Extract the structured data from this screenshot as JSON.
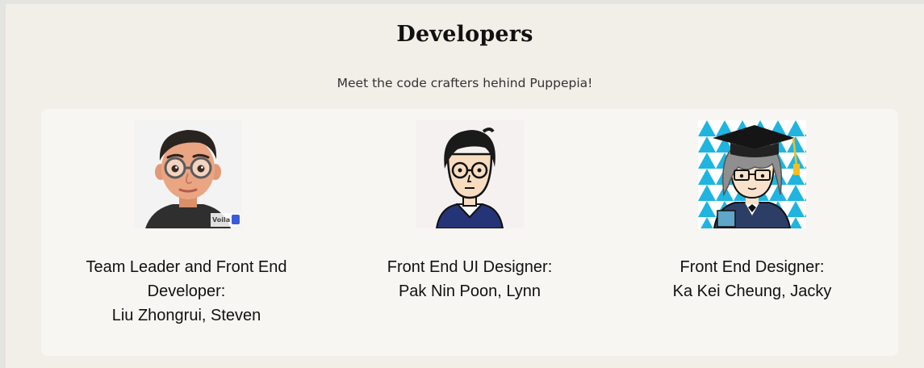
{
  "section": {
    "title": "Developers",
    "subtitle": "Meet the code crafters hehind Puppepia!"
  },
  "developers": [
    {
      "role_line1": "Team Leader and Front End",
      "role_line2": "Developer:",
      "name": "Liu Zhongrui, Steven",
      "avatar_icon": "3d-cartoon-man-glasses-avatar",
      "watermark": "Voila"
    },
    {
      "role_line1": "Front End UI Designer:",
      "name": "Pak Nin Poon, Lynn",
      "avatar_icon": "cartoon-man-glasses-avatar"
    },
    {
      "role_line1": "Front End Designer:",
      "name": "Ka Kei Cheung, Jacky",
      "avatar_icon": "anime-graduate-avatar"
    }
  ],
  "colors": {
    "page_background": "#f2eee8",
    "card_background": "#f7f6f2",
    "outer_background": "#e4e4e1",
    "triangle_blue": "#1fb5e0"
  }
}
